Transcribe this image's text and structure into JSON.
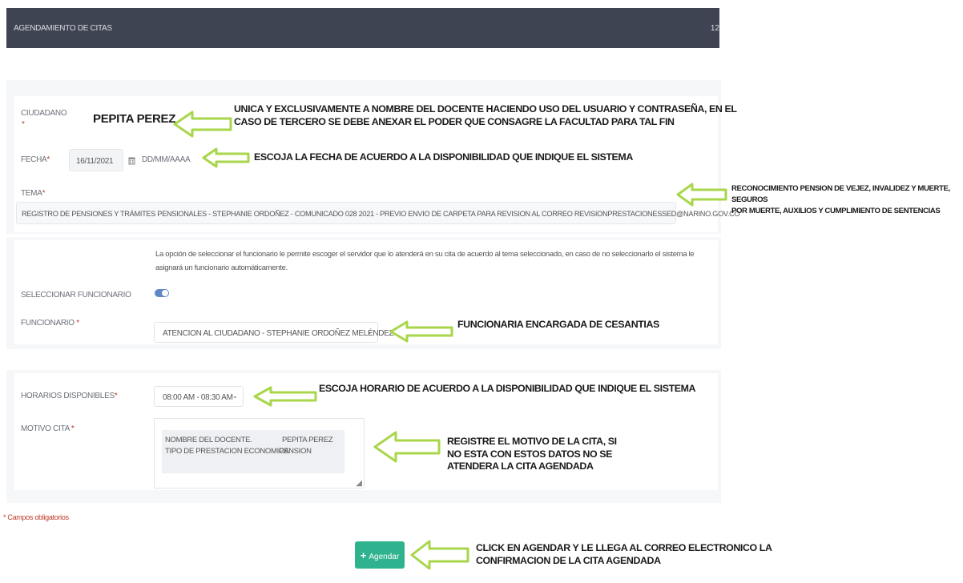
{
  "header": {
    "title": "AGENDAMIENTO DE CITAS",
    "right_text": "12"
  },
  "form": {
    "ciudadano": {
      "label": "CIUDADANO",
      "required_mark": "*",
      "value": "PEPITA PEREZ"
    },
    "fecha": {
      "label": "FECHA",
      "required_mark": "*",
      "value": "16/11/2021",
      "format_hint": "DD/MM/AAAA"
    },
    "tema": {
      "label": "TEMA",
      "required_mark": "*",
      "value": "REGISTRO DE PENSIONES Y TRÁMITES PENSIONALES - STEPHANIE ORDOÑEZ - COMUNICADO 028 2021 - PREVIO ENVIO DE CARPETA PARA REVISION AL CORREO REVISIONPRESTACIONESSED@NARINO.GOV.CO"
    },
    "funcionario_info": "La opción de seleccionar el funcionario le permite escoger el servidor que lo atenderá en su cita de acuerdo al tema seleccionado, en caso de no seleccionarlo el sistema le asignará un funcionario automáticamente.",
    "seleccionar_funcionario": {
      "label": "SELECCIONAR FUNCIONARIO",
      "enabled": true
    },
    "funcionario": {
      "label": "FUNCIONARIO",
      "required_mark": "*",
      "value": "ATENCION AL CIUDADANO - STEPHANIE ORDOÑEZ MELÉNDEZ"
    },
    "horarios": {
      "label": "HORARIOS DISPONIBLES",
      "required_mark": "*",
      "value": "08:00 AM - 08:30 AM"
    },
    "motivo": {
      "label": "MOTIVO CITA",
      "required_mark": "*",
      "line1_left": "NOMBRE DEL DOCENTE.",
      "line1_right": "PEPITA PEREZ",
      "line2_left": "TIPO DE PRESTACION ECONOMICA",
      "line2_right": "PENSION"
    },
    "required_note_mark": "*",
    "required_note": "Campos obligatorios",
    "submit_icon": "+",
    "submit_label": "Agendar"
  },
  "annotations": {
    "ciudadano_note_line1": "UNICA Y EXCLUSIVAMENTE A NOMBRE DEL DOCENTE HACIENDO USO DEL USUARIO Y CONTRASEÑA, EN EL",
    "ciudadano_note_line2": "CASO DE TERCERO SE DEBE ANEXAR EL PODER QUE CONSAGRE LA FACULTAD PARA TAL FIN",
    "fecha_note": "ESCOJA LA FECHA DE ACUERDO A LA DISPONIBILIDAD QUE INDIQUE EL SISTEMA",
    "tema_note_line1": "RECONOCIMIENTO PENSION DE VEJEZ, INVALIDEZ Y MUERTE, SEGUROS",
    "tema_note_line2": "POR MUERTE, AUXILIOS Y CUMPLIMIENTO DE SENTENCIAS",
    "funcionario_note": "FUNCIONARIA ENCARGADA DE CESANTIAS",
    "horario_note": "ESCOJA HORARIO DE ACUERDO A LA DISPONIBILIDAD QUE INDIQUE EL SISTEMA",
    "motivo_note_line1": "REGISTRE EL MOTIVO DE LA CITA, SI",
    "motivo_note_line2": "NO ESTA CON ESTOS DATOS NO SE",
    "motivo_note_line3": "ATENDERA LA CITA AGENDADA",
    "agendar_note_line1": "CLICK EN AGENDAR Y LE LLEGA AL CORREO ELECTRONICO LA",
    "agendar_note_line2": "CONFIRMACION DE LA CITA AGENDADA"
  },
  "colors": {
    "header_bg": "#3e4452",
    "accent_green": "#2fb38f",
    "arrow_green": "#a8d64a",
    "toggle_blue": "#5e88c6",
    "required_red": "#c0392b"
  },
  "icons": [
    "calendar-icon",
    "chevron-down-icon",
    "plus-icon",
    "arrow-left-icon",
    "resize-handle-icon"
  ]
}
